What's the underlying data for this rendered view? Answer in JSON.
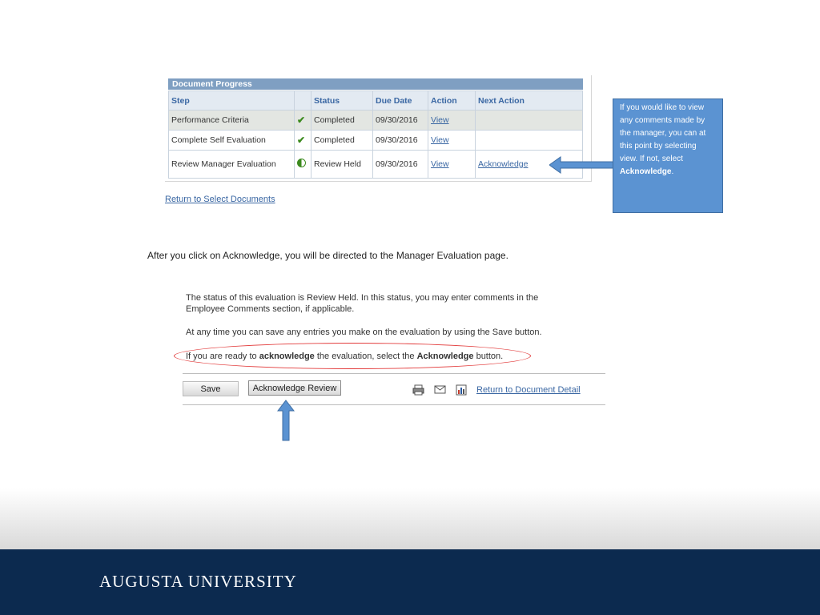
{
  "document_progress": {
    "title": "Document Progress",
    "headers": [
      "Step",
      "",
      "Status",
      "Due Date",
      "Action",
      "Next Action"
    ],
    "rows": [
      {
        "step": "Performance Criteria",
        "status_icon": "check-icon",
        "status": "Completed",
        "due_date": "09/30/2016",
        "action": "View",
        "next_action": ""
      },
      {
        "step": "Complete Self Evaluation",
        "status_icon": "check-icon",
        "status": "Completed",
        "due_date": "09/30/2016",
        "action": "View",
        "next_action": ""
      },
      {
        "step": "Review Manager Evaluation",
        "status_icon": "half-circle-icon",
        "status": "Review Held",
        "due_date": "09/30/2016",
        "action": "View",
        "next_action": "Acknowledge"
      }
    ],
    "return_link": "Return to Select Documents"
  },
  "callout": {
    "text_before": "If you would like to view any comments made by the manager, you can at this point by selecting view.  If not, select ",
    "emphasis": "Acknowledge",
    "text_after": "."
  },
  "instruction": "After you click on Acknowledge, you will be directed to the Manager Evaluation page.",
  "evaluation": {
    "paragraph1": "The status of this evaluation is Review Held. In this status, you may enter comments in the Employee Comments section, if applicable.",
    "paragraph2": "At any time you can save any entries you make on the evaluation by using the Save button.",
    "p3_part1": "If you are ready to ",
    "p3_bold1": "acknowledge",
    "p3_part2": " the evaluation, select the ",
    "p3_bold2": "Acknowledge",
    "p3_part3": " button.",
    "save_label": "Save",
    "acknowledge_label": "Acknowledge Review",
    "return_link": "Return to Document Detail",
    "icons": [
      "print-icon",
      "email-icon",
      "report-icon"
    ]
  },
  "footer": {
    "name": "AUGUSTA UNIVERSITY"
  },
  "colors": {
    "footer_bg": "#0c2a4f",
    "callout_bg": "#5b93d2",
    "header_bg": "#7f9fc2",
    "link": "#3a67a3",
    "highlight_ellipse": "#e23a3a"
  }
}
